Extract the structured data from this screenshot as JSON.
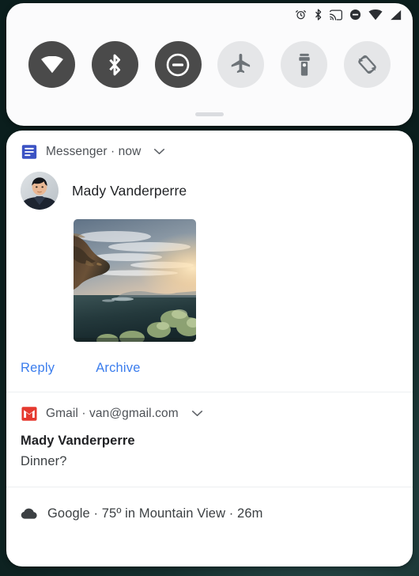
{
  "theme": {
    "wallpaper_color": "#0d2321",
    "panel_bg": "#ffffff",
    "qs_panel_bg": "#fbfbfc",
    "tile_on_color": "#4a4a4a",
    "tile_off_color": "#e5e6e8",
    "action_link_color": "#3b7ded",
    "messenger_blue": "#3c53c4",
    "gmail_red": "#e5392f",
    "divider_color": "#eceff1"
  },
  "status_bar": {
    "icons": [
      {
        "name": "alarm-icon",
        "label": "Alarm set"
      },
      {
        "name": "bluetooth-icon",
        "label": "Bluetooth on"
      },
      {
        "name": "cast-icon",
        "label": "Casting"
      },
      {
        "name": "do-not-disturb-icon",
        "label": "Do not disturb on"
      },
      {
        "name": "wifi-icon",
        "label": "Wi-Fi full signal"
      },
      {
        "name": "cell-signal-icon",
        "label": "Mobile signal"
      }
    ]
  },
  "quick_settings": {
    "tiles": [
      {
        "name": "wifi-tile",
        "label": "Wi-Fi",
        "state": "on"
      },
      {
        "name": "bluetooth-tile",
        "label": "Bluetooth",
        "state": "on"
      },
      {
        "name": "do-not-disturb-tile",
        "label": "Do Not Disturb",
        "state": "on"
      },
      {
        "name": "airplane-mode-tile",
        "label": "Airplane mode",
        "state": "off"
      },
      {
        "name": "flashlight-tile",
        "label": "Flashlight",
        "state": "off"
      },
      {
        "name": "auto-rotate-tile",
        "label": "Auto-rotate",
        "state": "off"
      }
    ],
    "drag_handle_label": "Expand quick settings"
  },
  "notifications": [
    {
      "id": "messenger",
      "app_name": "Messenger",
      "header": "Messenger · now",
      "time": "now",
      "sender": "Mady Vanderperre",
      "image_alt": "Sunset over a valley seen from a rocky cliff",
      "actions": [
        {
          "name": "reply-button",
          "label": "Reply"
        },
        {
          "name": "archive-button",
          "label": "Archive"
        }
      ]
    },
    {
      "id": "gmail",
      "app_name": "Gmail",
      "header": "Gmail · van@gmail.com",
      "account": "van@gmail.com",
      "title": "Mady Vanderperre",
      "text": "Dinner?"
    },
    {
      "id": "google-weather",
      "app_name": "Google",
      "header": "Google · 75º in Mountain View · 26m",
      "temperature": "75º",
      "location": "Mountain View",
      "time": "26m"
    }
  ]
}
